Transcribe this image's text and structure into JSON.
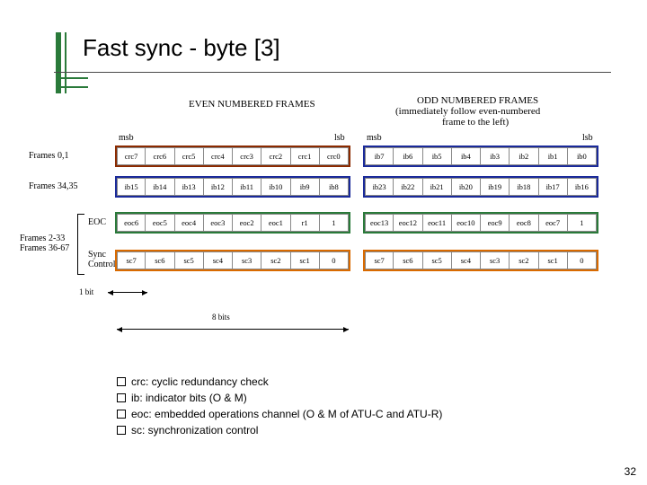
{
  "title": "Fast sync - byte [3]",
  "page_number": "32",
  "headers": {
    "even": "EVEN NUMBERED FRAMES",
    "odd_l1": "ODD NUMBERED FRAMES",
    "odd_l2": "(immediately follow even-numbered",
    "odd_l3": "frame to the left)"
  },
  "bit_labels": {
    "msb": "msb",
    "lsb": "lsb"
  },
  "row_labels": {
    "r0": "Frames 0,1",
    "r1": "Frames 34,35",
    "r2a": "EOC",
    "r2b": "Sync\nControl",
    "r3": "Frames 2-33\nFrames 36-67"
  },
  "rows": {
    "crc_even": [
      "crc7",
      "crc6",
      "crc5",
      "crc4",
      "crc3",
      "crc2",
      "crc1",
      "crc0"
    ],
    "crc_odd": [
      "ib7",
      "ib6",
      "ib5",
      "ib4",
      "ib3",
      "ib2",
      "ib1",
      "ib0"
    ],
    "ib_even": [
      "ib15",
      "ib14",
      "ib13",
      "ib12",
      "ib11",
      "ib10",
      "ib9",
      "ib8"
    ],
    "ib_odd": [
      "ib23",
      "ib22",
      "ib21",
      "ib20",
      "ib19",
      "ib18",
      "ib17",
      "ib16"
    ],
    "eoc_even": [
      "eoc6",
      "eoc5",
      "eoc4",
      "eoc3",
      "eoc2",
      "eoc1",
      "r1",
      "1"
    ],
    "eoc_odd": [
      "eoc13",
      "eoc12",
      "eoc11",
      "eoc10",
      "eoc9",
      "eoc8",
      "eoc7",
      "1"
    ],
    "sc_even": [
      "sc7",
      "sc6",
      "sc5",
      "sc4",
      "sc3",
      "sc2",
      "sc1",
      "0"
    ],
    "sc_odd": [
      "sc7",
      "sc6",
      "sc5",
      "sc4",
      "sc3",
      "sc2",
      "sc1",
      "0"
    ]
  },
  "scales": {
    "one_bit": "1 bit",
    "eight_bits": "8 bits"
  },
  "legend": {
    "crc": "crc: cyclic redundancy check",
    "ib": "ib: indicator bits (O & M)",
    "eoc": "eoc: embedded operations channel (O & M of ATU-C and ATU-R)",
    "sc": "sc: synchronization control"
  },
  "colors": {
    "crc": "#8b2a00",
    "ib": "#1a2a9a",
    "eoc": "#2a7a3a",
    "sc": "#d96a00"
  }
}
